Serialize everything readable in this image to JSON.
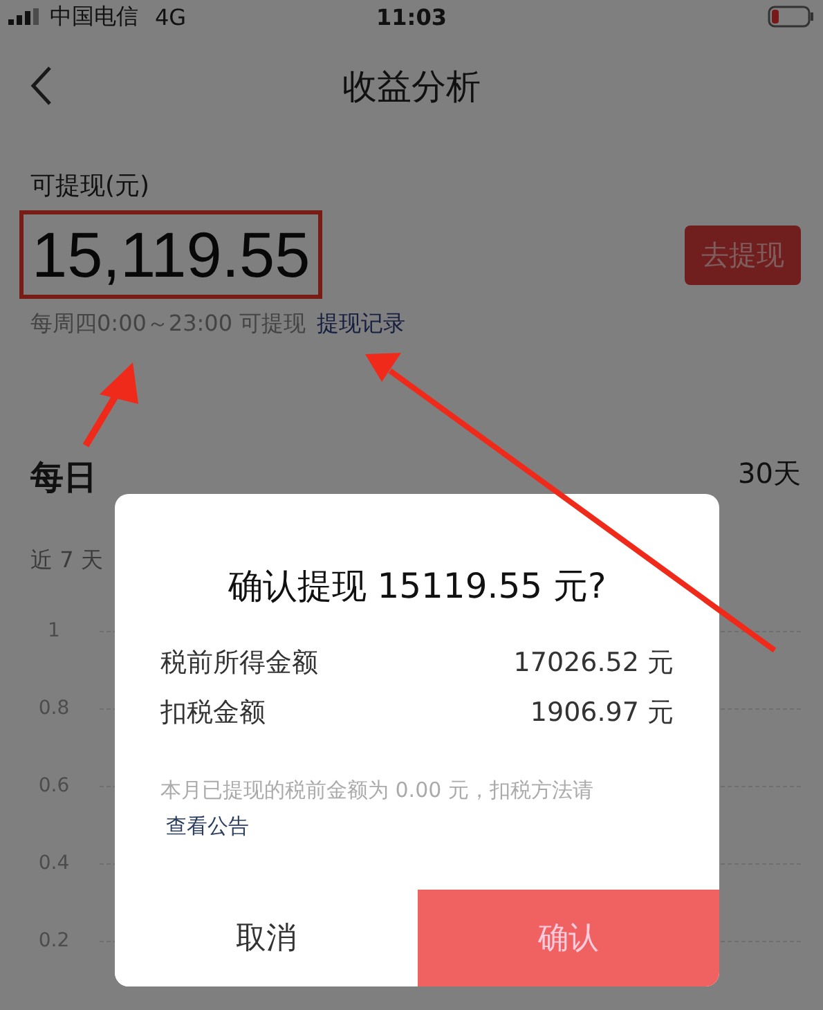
{
  "status_bar": {
    "carrier": "中国电信",
    "network": "4G",
    "time": "11:03"
  },
  "nav": {
    "title": "收益分析"
  },
  "balance": {
    "label": "可提现(元)",
    "amount": "15,119.55",
    "button": "去提现",
    "hint": "每周四0:00～23:00 可提现",
    "link": "提现记录"
  },
  "section": {
    "title": "每日",
    "range": "30天",
    "subtitle": "近 7 天",
    "y_axis_labels": [
      "1",
      "0.8",
      "0.6",
      "0.4",
      "0.2"
    ]
  },
  "dialog": {
    "title": "确认提现 15119.55 元?",
    "rows": [
      {
        "label": "税前所得金额",
        "value": "17026.52 元"
      },
      {
        "label": "扣税金额",
        "value": "1906.97 元"
      }
    ],
    "note": "本月已提现的税前金额为 0.00 元，扣税方法请",
    "note_link": "查看公告",
    "buttons": [
      {
        "label": "取消",
        "kind": "cancel"
      },
      {
        "label": "确认",
        "kind": "confirm"
      }
    ]
  }
}
